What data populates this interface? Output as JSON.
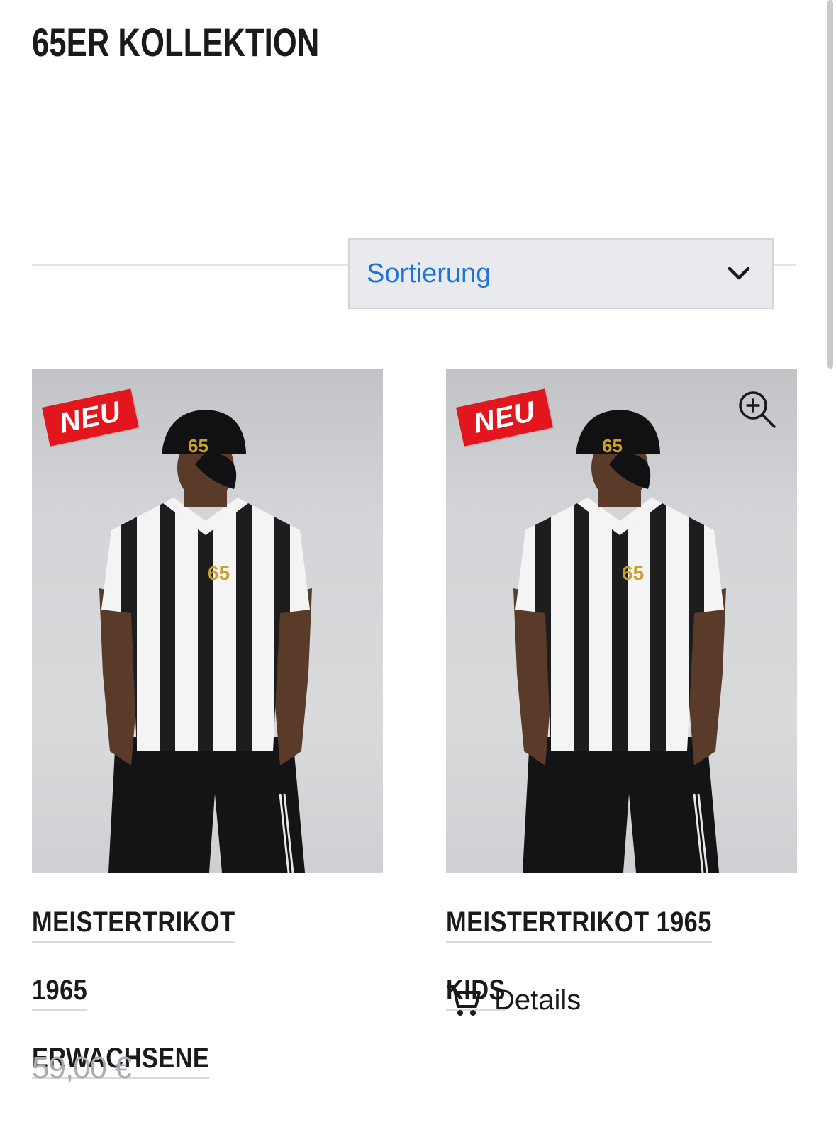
{
  "page": {
    "title": "65ER KOLLEKTION"
  },
  "sort": {
    "label": "Sortierung",
    "icon": "chevron-down-icon"
  },
  "products": [
    {
      "badge": "NEU",
      "name_line1": "MEISTERTRIKOT 1965",
      "name_line2": "ERWACHSENE",
      "price": "59,00 €",
      "image_icon": "product-photo"
    },
    {
      "badge": "NEU",
      "name_line1": "MEISTERTRIKOT 1965 KIDS",
      "details_label": "Details",
      "cart_icon": "cart-icon",
      "zoom_icon": "zoom-in-icon",
      "image_icon": "product-photo"
    }
  ],
  "colors": {
    "badge_red": "#e3161d",
    "sort_text_blue": "#1a73d9",
    "sort_bg": "#e9eaee",
    "price_gray": "#a9abb0",
    "title_black": "#1a1a1a"
  }
}
